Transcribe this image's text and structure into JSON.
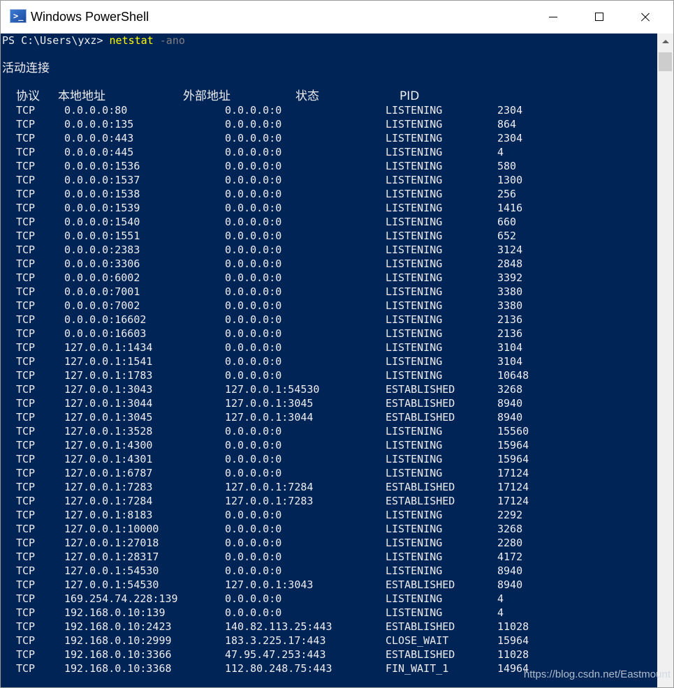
{
  "window": {
    "title": "Windows PowerShell"
  },
  "console": {
    "prompt": "PS C:\\Users\\yxz> ",
    "command": "netstat",
    "args": " -ano",
    "section_title": "活动连接",
    "headers": {
      "proto": "协议",
      "local": "本地地址",
      "foreign": "外部地址",
      "state": "状态",
      "pid": "PID"
    },
    "rows": [
      {
        "proto": "TCP",
        "local": "0.0.0.0:80",
        "foreign": "0.0.0.0:0",
        "state": "LISTENING",
        "pid": "2304"
      },
      {
        "proto": "TCP",
        "local": "0.0.0.0:135",
        "foreign": "0.0.0.0:0",
        "state": "LISTENING",
        "pid": "864"
      },
      {
        "proto": "TCP",
        "local": "0.0.0.0:443",
        "foreign": "0.0.0.0:0",
        "state": "LISTENING",
        "pid": "2304"
      },
      {
        "proto": "TCP",
        "local": "0.0.0.0:445",
        "foreign": "0.0.0.0:0",
        "state": "LISTENING",
        "pid": "4"
      },
      {
        "proto": "TCP",
        "local": "0.0.0.0:1536",
        "foreign": "0.0.0.0:0",
        "state": "LISTENING",
        "pid": "580"
      },
      {
        "proto": "TCP",
        "local": "0.0.0.0:1537",
        "foreign": "0.0.0.0:0",
        "state": "LISTENING",
        "pid": "1300"
      },
      {
        "proto": "TCP",
        "local": "0.0.0.0:1538",
        "foreign": "0.0.0.0:0",
        "state": "LISTENING",
        "pid": "256"
      },
      {
        "proto": "TCP",
        "local": "0.0.0.0:1539",
        "foreign": "0.0.0.0:0",
        "state": "LISTENING",
        "pid": "1416"
      },
      {
        "proto": "TCP",
        "local": "0.0.0.0:1540",
        "foreign": "0.0.0.0:0",
        "state": "LISTENING",
        "pid": "660"
      },
      {
        "proto": "TCP",
        "local": "0.0.0.0:1551",
        "foreign": "0.0.0.0:0",
        "state": "LISTENING",
        "pid": "652"
      },
      {
        "proto": "TCP",
        "local": "0.0.0.0:2383",
        "foreign": "0.0.0.0:0",
        "state": "LISTENING",
        "pid": "3124"
      },
      {
        "proto": "TCP",
        "local": "0.0.0.0:3306",
        "foreign": "0.0.0.0:0",
        "state": "LISTENING",
        "pid": "2848"
      },
      {
        "proto": "TCP",
        "local": "0.0.0.0:6002",
        "foreign": "0.0.0.0:0",
        "state": "LISTENING",
        "pid": "3392"
      },
      {
        "proto": "TCP",
        "local": "0.0.0.0:7001",
        "foreign": "0.0.0.0:0",
        "state": "LISTENING",
        "pid": "3380"
      },
      {
        "proto": "TCP",
        "local": "0.0.0.0:7002",
        "foreign": "0.0.0.0:0",
        "state": "LISTENING",
        "pid": "3380"
      },
      {
        "proto": "TCP",
        "local": "0.0.0.0:16602",
        "foreign": "0.0.0.0:0",
        "state": "LISTENING",
        "pid": "2136"
      },
      {
        "proto": "TCP",
        "local": "0.0.0.0:16603",
        "foreign": "0.0.0.0:0",
        "state": "LISTENING",
        "pid": "2136"
      },
      {
        "proto": "TCP",
        "local": "127.0.0.1:1434",
        "foreign": "0.0.0.0:0",
        "state": "LISTENING",
        "pid": "3104"
      },
      {
        "proto": "TCP",
        "local": "127.0.0.1:1541",
        "foreign": "0.0.0.0:0",
        "state": "LISTENING",
        "pid": "3104"
      },
      {
        "proto": "TCP",
        "local": "127.0.0.1:1783",
        "foreign": "0.0.0.0:0",
        "state": "LISTENING",
        "pid": "10648"
      },
      {
        "proto": "TCP",
        "local": "127.0.0.1:3043",
        "foreign": "127.0.0.1:54530",
        "state": "ESTABLISHED",
        "pid": "3268"
      },
      {
        "proto": "TCP",
        "local": "127.0.0.1:3044",
        "foreign": "127.0.0.1:3045",
        "state": "ESTABLISHED",
        "pid": "8940"
      },
      {
        "proto": "TCP",
        "local": "127.0.0.1:3045",
        "foreign": "127.0.0.1:3044",
        "state": "ESTABLISHED",
        "pid": "8940"
      },
      {
        "proto": "TCP",
        "local": "127.0.0.1:3528",
        "foreign": "0.0.0.0:0",
        "state": "LISTENING",
        "pid": "15560"
      },
      {
        "proto": "TCP",
        "local": "127.0.0.1:4300",
        "foreign": "0.0.0.0:0",
        "state": "LISTENING",
        "pid": "15964"
      },
      {
        "proto": "TCP",
        "local": "127.0.0.1:4301",
        "foreign": "0.0.0.0:0",
        "state": "LISTENING",
        "pid": "15964"
      },
      {
        "proto": "TCP",
        "local": "127.0.0.1:6787",
        "foreign": "0.0.0.0:0",
        "state": "LISTENING",
        "pid": "17124"
      },
      {
        "proto": "TCP",
        "local": "127.0.0.1:7283",
        "foreign": "127.0.0.1:7284",
        "state": "ESTABLISHED",
        "pid": "17124"
      },
      {
        "proto": "TCP",
        "local": "127.0.0.1:7284",
        "foreign": "127.0.0.1:7283",
        "state": "ESTABLISHED",
        "pid": "17124"
      },
      {
        "proto": "TCP",
        "local": "127.0.0.1:8183",
        "foreign": "0.0.0.0:0",
        "state": "LISTENING",
        "pid": "2292"
      },
      {
        "proto": "TCP",
        "local": "127.0.0.1:10000",
        "foreign": "0.0.0.0:0",
        "state": "LISTENING",
        "pid": "3268"
      },
      {
        "proto": "TCP",
        "local": "127.0.0.1:27018",
        "foreign": "0.0.0.0:0",
        "state": "LISTENING",
        "pid": "2280"
      },
      {
        "proto": "TCP",
        "local": "127.0.0.1:28317",
        "foreign": "0.0.0.0:0",
        "state": "LISTENING",
        "pid": "4172"
      },
      {
        "proto": "TCP",
        "local": "127.0.0.1:54530",
        "foreign": "0.0.0.0:0",
        "state": "LISTENING",
        "pid": "8940"
      },
      {
        "proto": "TCP",
        "local": "127.0.0.1:54530",
        "foreign": "127.0.0.1:3043",
        "state": "ESTABLISHED",
        "pid": "8940"
      },
      {
        "proto": "TCP",
        "local": "169.254.74.228:139",
        "foreign": "0.0.0.0:0",
        "state": "LISTENING",
        "pid": "4"
      },
      {
        "proto": "TCP",
        "local": "192.168.0.10:139",
        "foreign": "0.0.0.0:0",
        "state": "LISTENING",
        "pid": "4"
      },
      {
        "proto": "TCP",
        "local": "192.168.0.10:2423",
        "foreign": "140.82.113.25:443",
        "state": "ESTABLISHED",
        "pid": "11028"
      },
      {
        "proto": "TCP",
        "local": "192.168.0.10:2999",
        "foreign": "183.3.225.17:443",
        "state": "CLOSE_WAIT",
        "pid": "15964"
      },
      {
        "proto": "TCP",
        "local": "192.168.0.10:3366",
        "foreign": "47.95.47.253:443",
        "state": "ESTABLISHED",
        "pid": "11028"
      },
      {
        "proto": "TCP",
        "local": "192.168.0.10:3368",
        "foreign": "112.80.248.75:443",
        "state": "FIN_WAIT_1",
        "pid": "14964"
      }
    ]
  },
  "watermark": "https://blog.csdn.net/Eastmount",
  "colors": {
    "console_bg": "#012456",
    "console_fg": "#eeedf0",
    "command": "#ffff00",
    "argument": "#808080"
  },
  "icons": {
    "app": "powershell-icon",
    "minimize": "minimize-icon",
    "maximize": "maximize-icon",
    "close": "close-icon",
    "scroll_up": "chevron-up-icon"
  }
}
